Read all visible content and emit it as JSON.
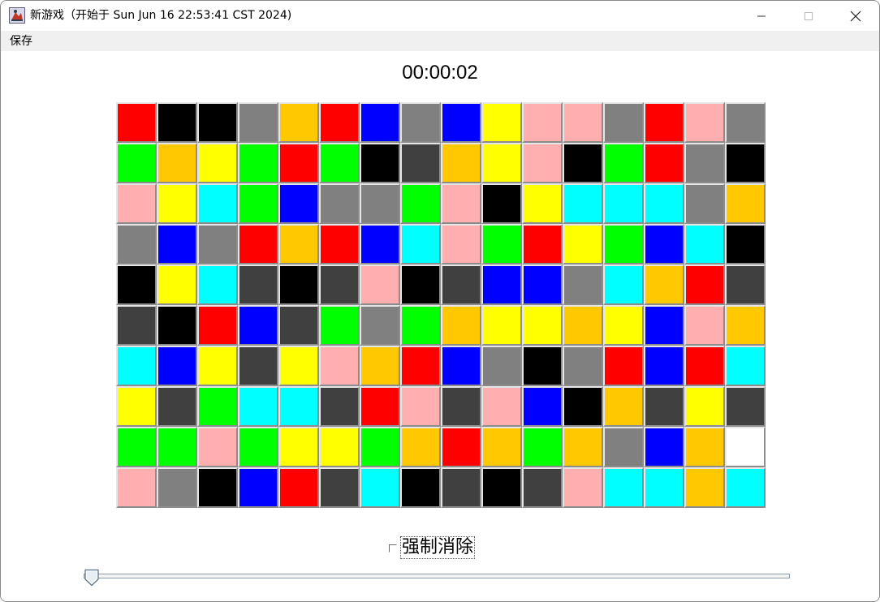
{
  "window": {
    "title": "新游戏（开始于 Sun Jun 16 22:53:41 CST 2024)",
    "icon": "java-app-icon"
  },
  "menu": {
    "items": [
      "保存"
    ]
  },
  "game": {
    "timer": "00:00:02",
    "palette": {
      "R": "#ff0000",
      "K": "#000000",
      "G": "#808080",
      "O": "#ffc800",
      "B": "#0000ff",
      "Y": "#ffff00",
      "P": "#ffafaf",
      "N": "#00ff00",
      "D": "#404040",
      "C": "#00ffff"
    },
    "grid": [
      "RKKGORBGBYPPGRPG",
      "NOYNRNKDOYPKNRGK",
      "PYCNBGGNPKYCCCGO",
      "GBGRORBCPNRYNBCK",
      "KYCDKDPKDBBGCORD",
      "DKRBDNGNOYYOYBPO",
      "CBYDYPORBGKGRBRC",
      "YDNCCDRPDPBKODYD",
      "NNPNYYNORONOGBO",
      "PGKBRDCKDKDPCCOC"
    ]
  },
  "controls": {
    "force_clear_label": "强制消除",
    "force_clear_checked": false,
    "slider_value": 0
  }
}
